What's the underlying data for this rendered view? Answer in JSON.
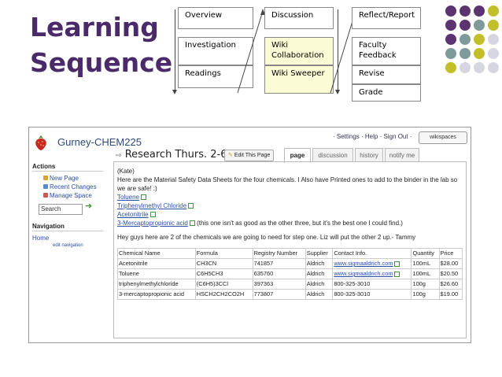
{
  "slide": {
    "title_line1": "Learning",
    "title_line2": "Sequence"
  },
  "sequence": {
    "col1": [
      "Overview",
      "Investigation",
      "Readings"
    ],
    "col2": [
      "Discussion",
      "Wiki Collaboration",
      "Wiki Sweeper"
    ],
    "col3": [
      "Reflect/Report",
      "Faculty Feedback",
      "Revise",
      "Grade"
    ]
  },
  "colors": {
    "title": "#4b2a6a",
    "highlight_box": "#fbfbd6",
    "dot_purple": "#5c3470",
    "dot_gray": "#7f9a9a",
    "dot_olive": "#c3bf2a",
    "dot_light": "#d6d6e0"
  },
  "wiki": {
    "site_name": "Gurney-CHEM225",
    "top_links": [
      "Settings",
      "Help",
      "Sign Out"
    ],
    "wikispaces_label": "wikispaces",
    "sidebar": {
      "actions_heading": "Actions",
      "actions": [
        "New Page",
        "Recent Changes",
        "Manage Space"
      ],
      "search_value": "Search",
      "navigation_heading": "Navigation",
      "home_link": "Home",
      "edit_nav_link": "edit navigation"
    },
    "page_title": "Research Thurs. 2-6",
    "edit_button": "Edit This Page",
    "tabs": [
      "page",
      "discussion",
      "history",
      "notify me"
    ],
    "active_tab": "page",
    "body": {
      "author": "(Kate)",
      "intro": "Here are the Material Safety Data Sheets for the four chemicals. I Also have Printed ones to add to the binder in the lab so we are safe! :)",
      "links": [
        "Toluene",
        "Triphenylmethyl Chloride",
        "Acetonitrile",
        "3-Mercaptopropionic acid"
      ],
      "link4_note": "(this one isn't as good as the other three, but it's the best one I could find.)",
      "message": "Hey guys here are 2 of the chemicals we are going to need for step one. Liz will put the other 2 up.- Tammy"
    },
    "table": {
      "headers": [
        "Chemical Name",
        "Formula",
        "Registry Number",
        "Supplier",
        "Contact Info.",
        "Quantity",
        "Price"
      ],
      "rows": [
        [
          "Acetonitrile",
          "CH3CN",
          "741857",
          "Aldrich",
          "www.sigmaaldrich.com",
          "100mL",
          "$28.00"
        ],
        [
          "Toluene",
          "C6H5CH3",
          "635760",
          "Aldrich",
          "www.sigmaaldrich.com",
          "100mL",
          "$20.50"
        ],
        [
          "triphenylmethylchloride",
          "(C6H5)3CCl",
          "397363",
          "Aldrich",
          "800-325-3010",
          "100g",
          "$26.60"
        ],
        [
          "3-mercaptopropionic acid",
          "HSCH2CH2CO2H",
          "773807",
          "Aldrich",
          "800-325-3010",
          "100g",
          "$19.00"
        ]
      ]
    }
  }
}
